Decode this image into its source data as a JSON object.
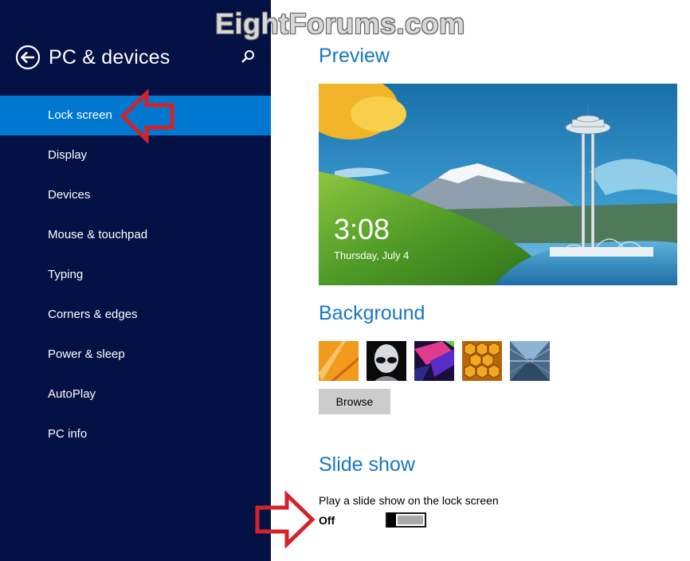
{
  "watermark": "EightForums.com",
  "sidebar": {
    "title": "PC & devices",
    "back_icon": "back-arrow-icon",
    "search_icon": "search-icon",
    "items": [
      {
        "label": "Lock screen",
        "selected": true
      },
      {
        "label": "Display"
      },
      {
        "label": "Devices"
      },
      {
        "label": "Mouse & touchpad"
      },
      {
        "label": "Typing"
      },
      {
        "label": "Corners & edges"
      },
      {
        "label": "Power & sleep"
      },
      {
        "label": "AutoPlay"
      },
      {
        "label": "PC info"
      }
    ]
  },
  "preview": {
    "title": "Preview",
    "time": "3:08",
    "date": "Thursday, July 4"
  },
  "background": {
    "title": "Background",
    "browse_label": "Browse"
  },
  "slideshow": {
    "title": "Slide show",
    "description": "Play a slide show on the lock screen",
    "state": "Off",
    "enabled": false
  },
  "colors": {
    "sidebar": "#041144",
    "selected": "#0078d0",
    "accent": "#1777c4",
    "annotation_arrow": "#d2232a"
  }
}
